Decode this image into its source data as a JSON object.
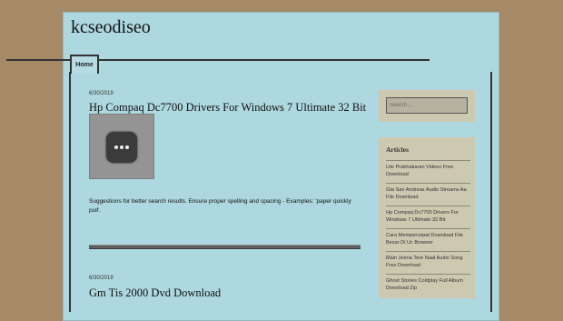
{
  "header": {
    "site_title": "kcseodiseo"
  },
  "nav": {
    "tabs": [
      {
        "label": "Home"
      }
    ]
  },
  "posts": [
    {
      "date": "6/30/2019",
      "title": "Hp Compaq Dc7700 Drivers For Windows 7 Ultimate 32 Bit",
      "snippet": "Suggestions for better search results. Ensure proper spelling and spacing - Examples: 'paper quickly pull'."
    },
    {
      "date": "6/30/2019",
      "title": "Gm Tis 2000 Dvd Download"
    }
  ],
  "sidebar": {
    "search": {
      "placeholder": "Search ..."
    },
    "articles": {
      "title": "Articles",
      "items": [
        {
          "label": "Lite Prabhakaran Videos Free Download"
        },
        {
          "label": "Gta San Andreas Audio Streams Aa File Download"
        },
        {
          "label": "Hp Compaq Dc7700 Drivers For Windows 7 Ultimate 32 Bit"
        },
        {
          "label": "Cara Mempercepat Download File Besar Di Uc Browser"
        },
        {
          "label": "Main Jeena Tere Naal Audio Song Free Download"
        },
        {
          "label": "Ghost Stories Coldplay Full Album Download Zip"
        }
      ]
    }
  },
  "colors": {
    "page_background": "#a68a68",
    "content_background": "#add8df",
    "widget_background": "#cdc8b0"
  },
  "icons": {
    "thumbnail": "more-options-icon"
  }
}
